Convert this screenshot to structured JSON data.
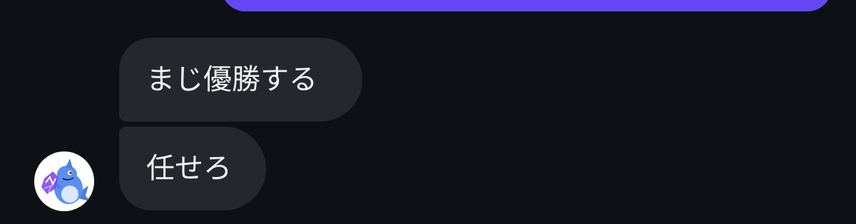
{
  "messages": {
    "outgoing_top": {
      "color": "#6448f5"
    },
    "incoming": [
      {
        "text": "まじ優勝する"
      },
      {
        "text": "任せろ"
      }
    ],
    "incoming_bubble_color": "#24272b"
  },
  "sender": {
    "avatar_icon": "shark-mascot-icon"
  }
}
